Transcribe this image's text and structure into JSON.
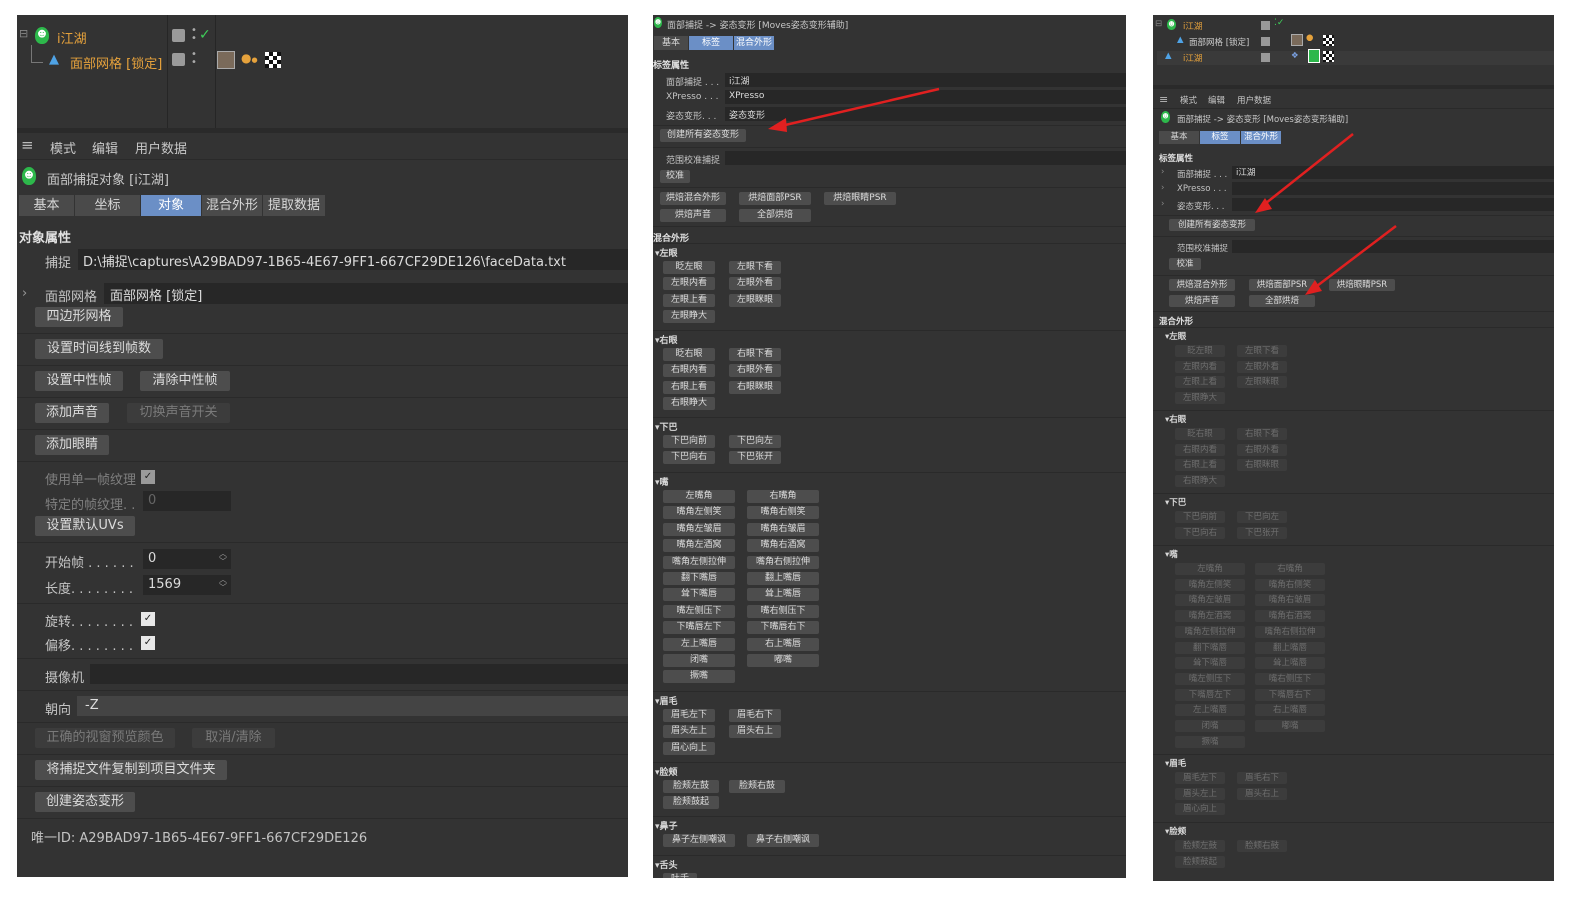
{
  "p1": {
    "tree": {
      "item1": "i江湖",
      "item2": "面部网格 [锁定]"
    },
    "menu": [
      "模式",
      "编辑",
      "用户数据"
    ],
    "object_title": "面部捕捉对象 [i江湖]",
    "tabs": [
      "基本",
      "坐标",
      "对象",
      "混合外形",
      "提取数据"
    ],
    "section": "对象属性",
    "capture_label": "捕捉",
    "capture_path": "D:\\捕捉\\captures\\A29BAD97-1B65-4E67-9FF1-667CF29DE126\\faceData.txt",
    "mesh_label": "面部网格",
    "mesh_value": "面部网格 [锁定]",
    "btn_quad": "四边形网格",
    "btn_timeline": "设置时间线到帧数",
    "btn_neutral": "设置中性帧",
    "btn_clear_neutral": "清除中性帧",
    "btn_add_sound": "添加声音",
    "btn_toggle_sound": "切换声音开关",
    "btn_add_eyes": "添加眼睛",
    "use_single_tex": "使用单一帧纹理",
    "specific_tex": "特定的帧纹理. .",
    "specific_tex_val": "0",
    "btn_default_uv": "设置默认UVs",
    "start_label": "开始帧 . . . . . .",
    "start_val": "0",
    "len_label": "长度. . . . . . . .",
    "len_val": "1569",
    "rot_label": "旋转. . . . . . . .",
    "offset_label": "偏移. . . . . . . .",
    "camera_label": "摄像机",
    "facing_label": "朝向",
    "facing_val": "-Z",
    "btn_preview_color": "正确的视窗预览颜色",
    "btn_cancel": "取消/清除",
    "btn_copy": "将捕捉文件复制到项目文件夹",
    "btn_create_pose": "创建姿态变形",
    "uid": "唯一ID:  A29BAD97-1B65-4E67-9FF1-667CF29DE126"
  },
  "p2": {
    "title": "面部捕捉 -> 姿态变形 [Moves姿态变形辅助]",
    "tabs": [
      "基本",
      "标签",
      "混合外形"
    ],
    "section": "标签属性",
    "f1_label": "面部捕捉 . . .",
    "f1_val": "i江湖",
    "f2_label": "XPresso . . .",
    "f2_val": "XPresso",
    "f3_label": "姿态变形. . .",
    "f3_val": "姿态变形",
    "btn_create_all": "创建所有姿态变形",
    "range_label": "范围校准捕捉",
    "btn_calib": "校准",
    "bake": [
      "烘焙混合外形",
      "烘焙面部PSR",
      "烘焙眼睛PSR",
      "烘焙声音",
      "全部烘焙"
    ],
    "blend_section": "混合外形",
    "groups": {
      "left_eye": "左眼",
      "right_eye": "右眼",
      "jaw": "下巴",
      "mouth": "嘴",
      "brow": "眉毛",
      "cheek": "脸颊",
      "nose": "鼻子",
      "tongue": "舌头"
    },
    "left_eye_btns": [
      "眨左眼",
      "左眼下看",
      "左眼内看",
      "左眼外看",
      "左眼上看",
      "左眼眯眼",
      "左眼睁大"
    ],
    "right_eye_btns": [
      "眨右眼",
      "右眼下看",
      "右眼内看",
      "右眼外看",
      "右眼上看",
      "右眼眯眼",
      "右眼睁大"
    ],
    "jaw_btns": [
      "下巴向前",
      "下巴向左",
      "下巴向右",
      "下巴张开"
    ],
    "mouth_btns": [
      "左嘴角",
      "右嘴角",
      "嘴角左侧笑",
      "嘴角右侧笑",
      "嘴角左皱眉",
      "嘴角右皱眉",
      "嘴角左酒窝",
      "嘴角右酒窝",
      "嘴角左侧拉伸",
      "嘴角右侧拉伸",
      "翻下嘴唇",
      "翻上嘴唇",
      "耸下嘴唇",
      "耸上嘴唇",
      "嘴左侧压下",
      "嘴右侧压下",
      "下嘴唇左下",
      "下嘴唇右下",
      "左上嘴唇",
      "右上嘴唇",
      "闭嘴",
      "嘟嘴",
      "撅嘴"
    ],
    "brow_btns": [
      "眉毛左下",
      "眉毛右下",
      "眉头左上",
      "眉头右上",
      "眉心向上"
    ],
    "cheek_btns": [
      "脸颊左鼓",
      "脸颊右鼓",
      "脸颊鼓起"
    ],
    "nose_btns": [
      "鼻子左侧嘲讽",
      "鼻子右侧嘲讽"
    ],
    "tongue_btns": [
      "吐舌"
    ]
  },
  "p3": {
    "tree": {
      "item1": "i江湖",
      "item2": "面部网格 [锁定]",
      "item3": "i江湖"
    },
    "menu": [
      "模式",
      "编辑",
      "用户数据"
    ],
    "title": "面部捕捉 -> 姿态变形 [Moves姿态变形辅助]",
    "tabs": [
      "基本",
      "标签",
      "混合外形"
    ],
    "section": "标签属性",
    "f1_label": "面部捕捉 . . .",
    "f1_val": "i江湖",
    "f2_label": "XPresso . . .",
    "f3_label": "姿态变形. . .",
    "btn_create_all": "创建所有姿态变形",
    "range_label": "范围校准捕捉",
    "btn_calib": "校准",
    "bake": [
      "烘焙混合外形",
      "烘焙面部PSR",
      "烘焙眼睛PSR",
      "烘焙声音",
      "全部烘焙"
    ],
    "blend_section": "混合外形",
    "groups": {
      "left_eye": "左眼",
      "right_eye": "右眼",
      "jaw": "下巴",
      "mouth": "嘴",
      "brow": "眉毛",
      "cheek": "脸颊"
    }
  },
  "colors": {
    "panel": "#333333",
    "tab_active": "#6b8fc6",
    "arrow": "#e02020",
    "face_icon": "#2db84b",
    "orange_text": "#e6a23c"
  }
}
